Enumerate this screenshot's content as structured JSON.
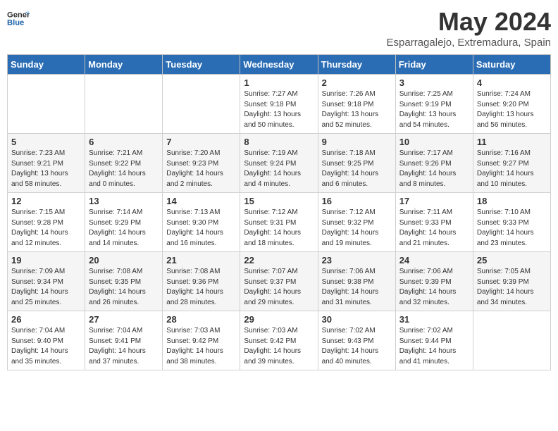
{
  "header": {
    "logo_line1": "General",
    "logo_line2": "Blue",
    "month_year": "May 2024",
    "location": "Esparragalejo, Extremadura, Spain"
  },
  "weekdays": [
    "Sunday",
    "Monday",
    "Tuesday",
    "Wednesday",
    "Thursday",
    "Friday",
    "Saturday"
  ],
  "weeks": [
    [
      {
        "day": "",
        "sunrise": "",
        "sunset": "",
        "daylight": ""
      },
      {
        "day": "",
        "sunrise": "",
        "sunset": "",
        "daylight": ""
      },
      {
        "day": "",
        "sunrise": "",
        "sunset": "",
        "daylight": ""
      },
      {
        "day": "1",
        "sunrise": "Sunrise: 7:27 AM",
        "sunset": "Sunset: 9:18 PM",
        "daylight": "Daylight: 13 hours and 50 minutes."
      },
      {
        "day": "2",
        "sunrise": "Sunrise: 7:26 AM",
        "sunset": "Sunset: 9:18 PM",
        "daylight": "Daylight: 13 hours and 52 minutes."
      },
      {
        "day": "3",
        "sunrise": "Sunrise: 7:25 AM",
        "sunset": "Sunset: 9:19 PM",
        "daylight": "Daylight: 13 hours and 54 minutes."
      },
      {
        "day": "4",
        "sunrise": "Sunrise: 7:24 AM",
        "sunset": "Sunset: 9:20 PM",
        "daylight": "Daylight: 13 hours and 56 minutes."
      }
    ],
    [
      {
        "day": "5",
        "sunrise": "Sunrise: 7:23 AM",
        "sunset": "Sunset: 9:21 PM",
        "daylight": "Daylight: 13 hours and 58 minutes."
      },
      {
        "day": "6",
        "sunrise": "Sunrise: 7:21 AM",
        "sunset": "Sunset: 9:22 PM",
        "daylight": "Daylight: 14 hours and 0 minutes."
      },
      {
        "day": "7",
        "sunrise": "Sunrise: 7:20 AM",
        "sunset": "Sunset: 9:23 PM",
        "daylight": "Daylight: 14 hours and 2 minutes."
      },
      {
        "day": "8",
        "sunrise": "Sunrise: 7:19 AM",
        "sunset": "Sunset: 9:24 PM",
        "daylight": "Daylight: 14 hours and 4 minutes."
      },
      {
        "day": "9",
        "sunrise": "Sunrise: 7:18 AM",
        "sunset": "Sunset: 9:25 PM",
        "daylight": "Daylight: 14 hours and 6 minutes."
      },
      {
        "day": "10",
        "sunrise": "Sunrise: 7:17 AM",
        "sunset": "Sunset: 9:26 PM",
        "daylight": "Daylight: 14 hours and 8 minutes."
      },
      {
        "day": "11",
        "sunrise": "Sunrise: 7:16 AM",
        "sunset": "Sunset: 9:27 PM",
        "daylight": "Daylight: 14 hours and 10 minutes."
      }
    ],
    [
      {
        "day": "12",
        "sunrise": "Sunrise: 7:15 AM",
        "sunset": "Sunset: 9:28 PM",
        "daylight": "Daylight: 14 hours and 12 minutes."
      },
      {
        "day": "13",
        "sunrise": "Sunrise: 7:14 AM",
        "sunset": "Sunset: 9:29 PM",
        "daylight": "Daylight: 14 hours and 14 minutes."
      },
      {
        "day": "14",
        "sunrise": "Sunrise: 7:13 AM",
        "sunset": "Sunset: 9:30 PM",
        "daylight": "Daylight: 14 hours and 16 minutes."
      },
      {
        "day": "15",
        "sunrise": "Sunrise: 7:12 AM",
        "sunset": "Sunset: 9:31 PM",
        "daylight": "Daylight: 14 hours and 18 minutes."
      },
      {
        "day": "16",
        "sunrise": "Sunrise: 7:12 AM",
        "sunset": "Sunset: 9:32 PM",
        "daylight": "Daylight: 14 hours and 19 minutes."
      },
      {
        "day": "17",
        "sunrise": "Sunrise: 7:11 AM",
        "sunset": "Sunset: 9:33 PM",
        "daylight": "Daylight: 14 hours and 21 minutes."
      },
      {
        "day": "18",
        "sunrise": "Sunrise: 7:10 AM",
        "sunset": "Sunset: 9:33 PM",
        "daylight": "Daylight: 14 hours and 23 minutes."
      }
    ],
    [
      {
        "day": "19",
        "sunrise": "Sunrise: 7:09 AM",
        "sunset": "Sunset: 9:34 PM",
        "daylight": "Daylight: 14 hours and 25 minutes."
      },
      {
        "day": "20",
        "sunrise": "Sunrise: 7:08 AM",
        "sunset": "Sunset: 9:35 PM",
        "daylight": "Daylight: 14 hours and 26 minutes."
      },
      {
        "day": "21",
        "sunrise": "Sunrise: 7:08 AM",
        "sunset": "Sunset: 9:36 PM",
        "daylight": "Daylight: 14 hours and 28 minutes."
      },
      {
        "day": "22",
        "sunrise": "Sunrise: 7:07 AM",
        "sunset": "Sunset: 9:37 PM",
        "daylight": "Daylight: 14 hours and 29 minutes."
      },
      {
        "day": "23",
        "sunrise": "Sunrise: 7:06 AM",
        "sunset": "Sunset: 9:38 PM",
        "daylight": "Daylight: 14 hours and 31 minutes."
      },
      {
        "day": "24",
        "sunrise": "Sunrise: 7:06 AM",
        "sunset": "Sunset: 9:39 PM",
        "daylight": "Daylight: 14 hours and 32 minutes."
      },
      {
        "day": "25",
        "sunrise": "Sunrise: 7:05 AM",
        "sunset": "Sunset: 9:39 PM",
        "daylight": "Daylight: 14 hours and 34 minutes."
      }
    ],
    [
      {
        "day": "26",
        "sunrise": "Sunrise: 7:04 AM",
        "sunset": "Sunset: 9:40 PM",
        "daylight": "Daylight: 14 hours and 35 minutes."
      },
      {
        "day": "27",
        "sunrise": "Sunrise: 7:04 AM",
        "sunset": "Sunset: 9:41 PM",
        "daylight": "Daylight: 14 hours and 37 minutes."
      },
      {
        "day": "28",
        "sunrise": "Sunrise: 7:03 AM",
        "sunset": "Sunset: 9:42 PM",
        "daylight": "Daylight: 14 hours and 38 minutes."
      },
      {
        "day": "29",
        "sunrise": "Sunrise: 7:03 AM",
        "sunset": "Sunset: 9:42 PM",
        "daylight": "Daylight: 14 hours and 39 minutes."
      },
      {
        "day": "30",
        "sunrise": "Sunrise: 7:02 AM",
        "sunset": "Sunset: 9:43 PM",
        "daylight": "Daylight: 14 hours and 40 minutes."
      },
      {
        "day": "31",
        "sunrise": "Sunrise: 7:02 AM",
        "sunset": "Sunset: 9:44 PM",
        "daylight": "Daylight: 14 hours and 41 minutes."
      },
      {
        "day": "",
        "sunrise": "",
        "sunset": "",
        "daylight": ""
      }
    ]
  ]
}
